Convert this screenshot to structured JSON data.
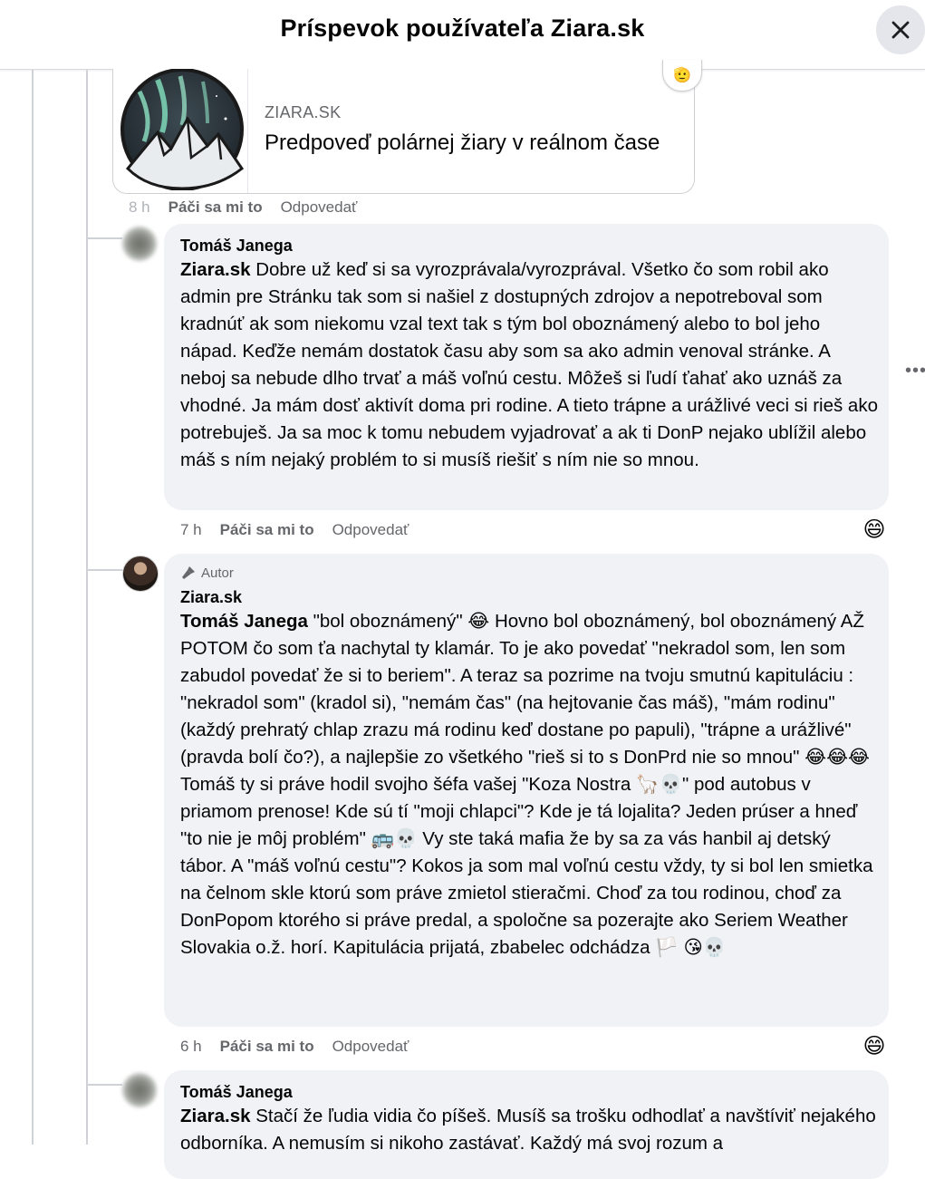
{
  "header": {
    "title": "Príspevok používateľa Ziara.sk",
    "close_icon": "close-icon"
  },
  "link_preview": {
    "source": "ZIARA.SK",
    "title": "Predpoveď polárnej žiary v reálnom čase",
    "badge": "🫡"
  },
  "comment0_meta": {
    "time": "8 h",
    "like": "Páči sa mi to",
    "reply": "Odpovedať"
  },
  "comment1": {
    "author": "Tomáš Janega",
    "mention": "Ziara.sk",
    "text": " Dobre už keď si sa vyrozprávala/vyrozprával. Všetko čo som robil ako admin pre Stránku tak som si našiel z dostupných zdrojov a nepotreboval som kradnúť ak som niekomu vzal text tak s tým bol oboznámený alebo to bol jeho nápad. Keďže nemám dostatok času aby som sa ako admin venoval stránke. A neboj sa nebude dlho trvať a máš voľnú cestu. Môžeš si ľudí ťahať ako uznáš za vhodné. Ja mám dosť aktivít doma pri rodine. A tieto trápne a urážlivé veci si rieš ako potrebuješ. Ja sa moc k tomu nebudem vyjadrovať a ak ti DonP nejako ublížil alebo máš s ním nejaký problém to si musíš riešiť s ním nie so mnou.",
    "time": "7 h",
    "like": "Páči sa mi to",
    "reply": "Odpovedať",
    "reaction": "😄"
  },
  "comment2": {
    "badge": "Autor",
    "author": "Ziara.sk",
    "mention": "Tomáš Janega",
    "text_parts": [
      " \"bol oboznámený\" ",
      " Hovno bol oboznámený, bol oboznámený AŽ POTOM čo som ťa nachytal ty klamár. To je ako povedať \"nekradol som, len som zabudol povedať že si to beriem\". A teraz sa pozrime na tvoju smutnú kapituláciu : \"nekradol som\" (kradol si), \"nemám čas\" (na hejtovanie čas máš), \"mám rodinu\" (každý prehratý chlap zrazu má rodinu keď dostane po papuli), \"trápne a urážlivé\" (pravda bolí čo?), a najlepšie zo všetkého \"rieš si to s DonPrd nie so mnou\" ",
      " Tomáš ty si práve hodil svojho šéfa vašej \"Koza Nostra ",
      "\" pod autobus v priamom prenose! Kde sú tí \"moji chlapci\"? Kde je tá lojalita? Jeden prúser a hneď \"to nie je môj problém\" ",
      " Vy ste taká mafia že by sa za vás hanbil aj detský tábor. A \"máš voľnú cestu\"? Kokos ja som mal voľnú cestu vždy, ty si bol len smietka na čelnom skle ktorú som práve zmietol stieračmi. Choď za tou rodinou, choď za DonPopom ktorého si práve predal, a spoločne sa pozerajte ako Seriem Weather Slovakia o.ž. horí. Kapitulácia prijatá, zbabelec odchádza "
    ],
    "emojis": [
      "😂",
      "😂😂😂",
      "🦙💀",
      "🚌💀",
      "🏳️",
      "😘💀"
    ],
    "time": "6 h",
    "like": "Páči sa mi to",
    "reply": "Odpovedať",
    "reaction": "😄"
  },
  "comment3": {
    "author": "Tomáš Janega",
    "mention": "Ziara.sk",
    "text": " Stačí že ľudia vidia čo píšeš. Musíš sa trošku odhodlať a navštíviť nejakého odborníka. A nemusím si nikoho zastávať. Každý má svoj rozum a"
  }
}
